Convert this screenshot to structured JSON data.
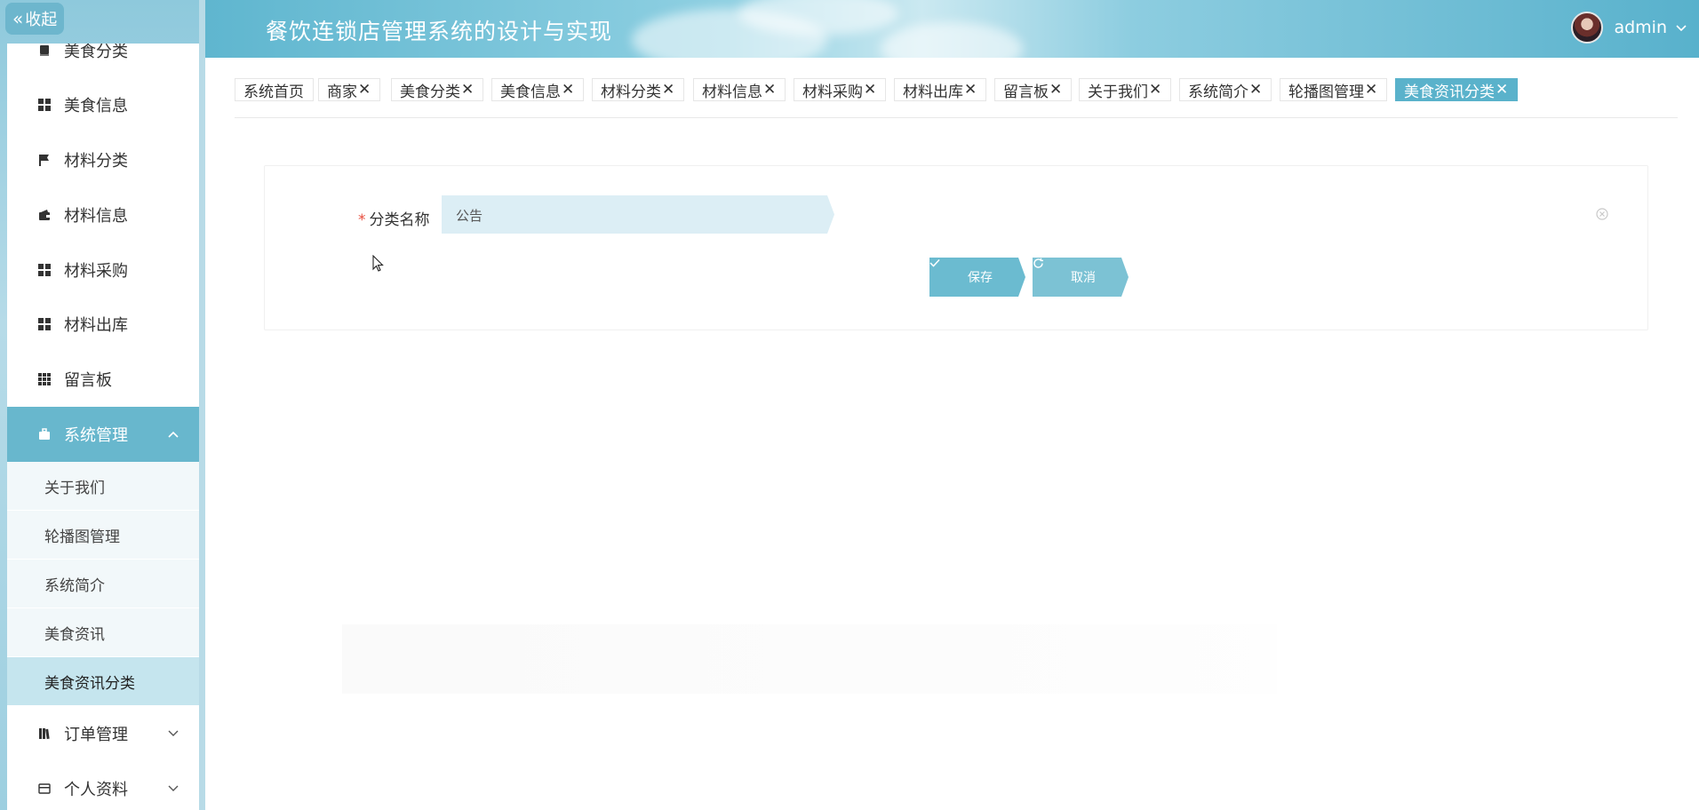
{
  "header": {
    "title": "餐饮连锁店管理系统的设计与实现",
    "username": "admin"
  },
  "sidebar": {
    "collapse_label": "收起",
    "items": [
      {
        "label": "美食分类",
        "icon": "book-icon"
      },
      {
        "label": "美食信息",
        "icon": "grid-icon"
      },
      {
        "label": "材料分类",
        "icon": "flag-icon"
      },
      {
        "label": "材料信息",
        "icon": "wallet-icon"
      },
      {
        "label": "材料采购",
        "icon": "grid-icon"
      },
      {
        "label": "材料出库",
        "icon": "grid-icon"
      },
      {
        "label": "留言板",
        "icon": "grid-small-icon"
      }
    ],
    "system_group": {
      "label": "系统管理",
      "icon": "briefcase-icon",
      "children": [
        {
          "label": "关于我们"
        },
        {
          "label": "轮播图管理"
        },
        {
          "label": "系统简介"
        },
        {
          "label": "美食资讯"
        },
        {
          "label": "美食资讯分类",
          "active": true
        }
      ]
    },
    "order_group": {
      "label": "订单管理",
      "icon": "books-icon"
    },
    "profile_group": {
      "label": "个人资料",
      "icon": "card-icon"
    }
  },
  "tags": [
    {
      "label": "系统首页",
      "closable": false
    },
    {
      "label": "商家",
      "closable": true
    },
    {
      "label": "美食分类",
      "closable": true
    },
    {
      "label": "美食信息",
      "closable": true
    },
    {
      "label": "材料分类",
      "closable": true
    },
    {
      "label": "材料信息",
      "closable": true
    },
    {
      "label": "材料采购",
      "closable": true
    },
    {
      "label": "材料出库",
      "closable": true
    },
    {
      "label": "留言板",
      "closable": true
    },
    {
      "label": "关于我们",
      "closable": true
    },
    {
      "label": "系统简介",
      "closable": true
    },
    {
      "label": "轮播图管理",
      "closable": true
    },
    {
      "label": "美食资讯分类",
      "closable": true,
      "active": true
    }
  ],
  "tag_close_glyph": "✕",
  "form": {
    "field_label": "分类名称",
    "required_mark": "*",
    "field_value": "公告",
    "save_label": "保存",
    "cancel_label": "取消"
  },
  "colors": {
    "accent": "#5ab2cb",
    "button": "#6bbbd0",
    "input_bg": "#dceef5",
    "required": "#e74c3c"
  }
}
